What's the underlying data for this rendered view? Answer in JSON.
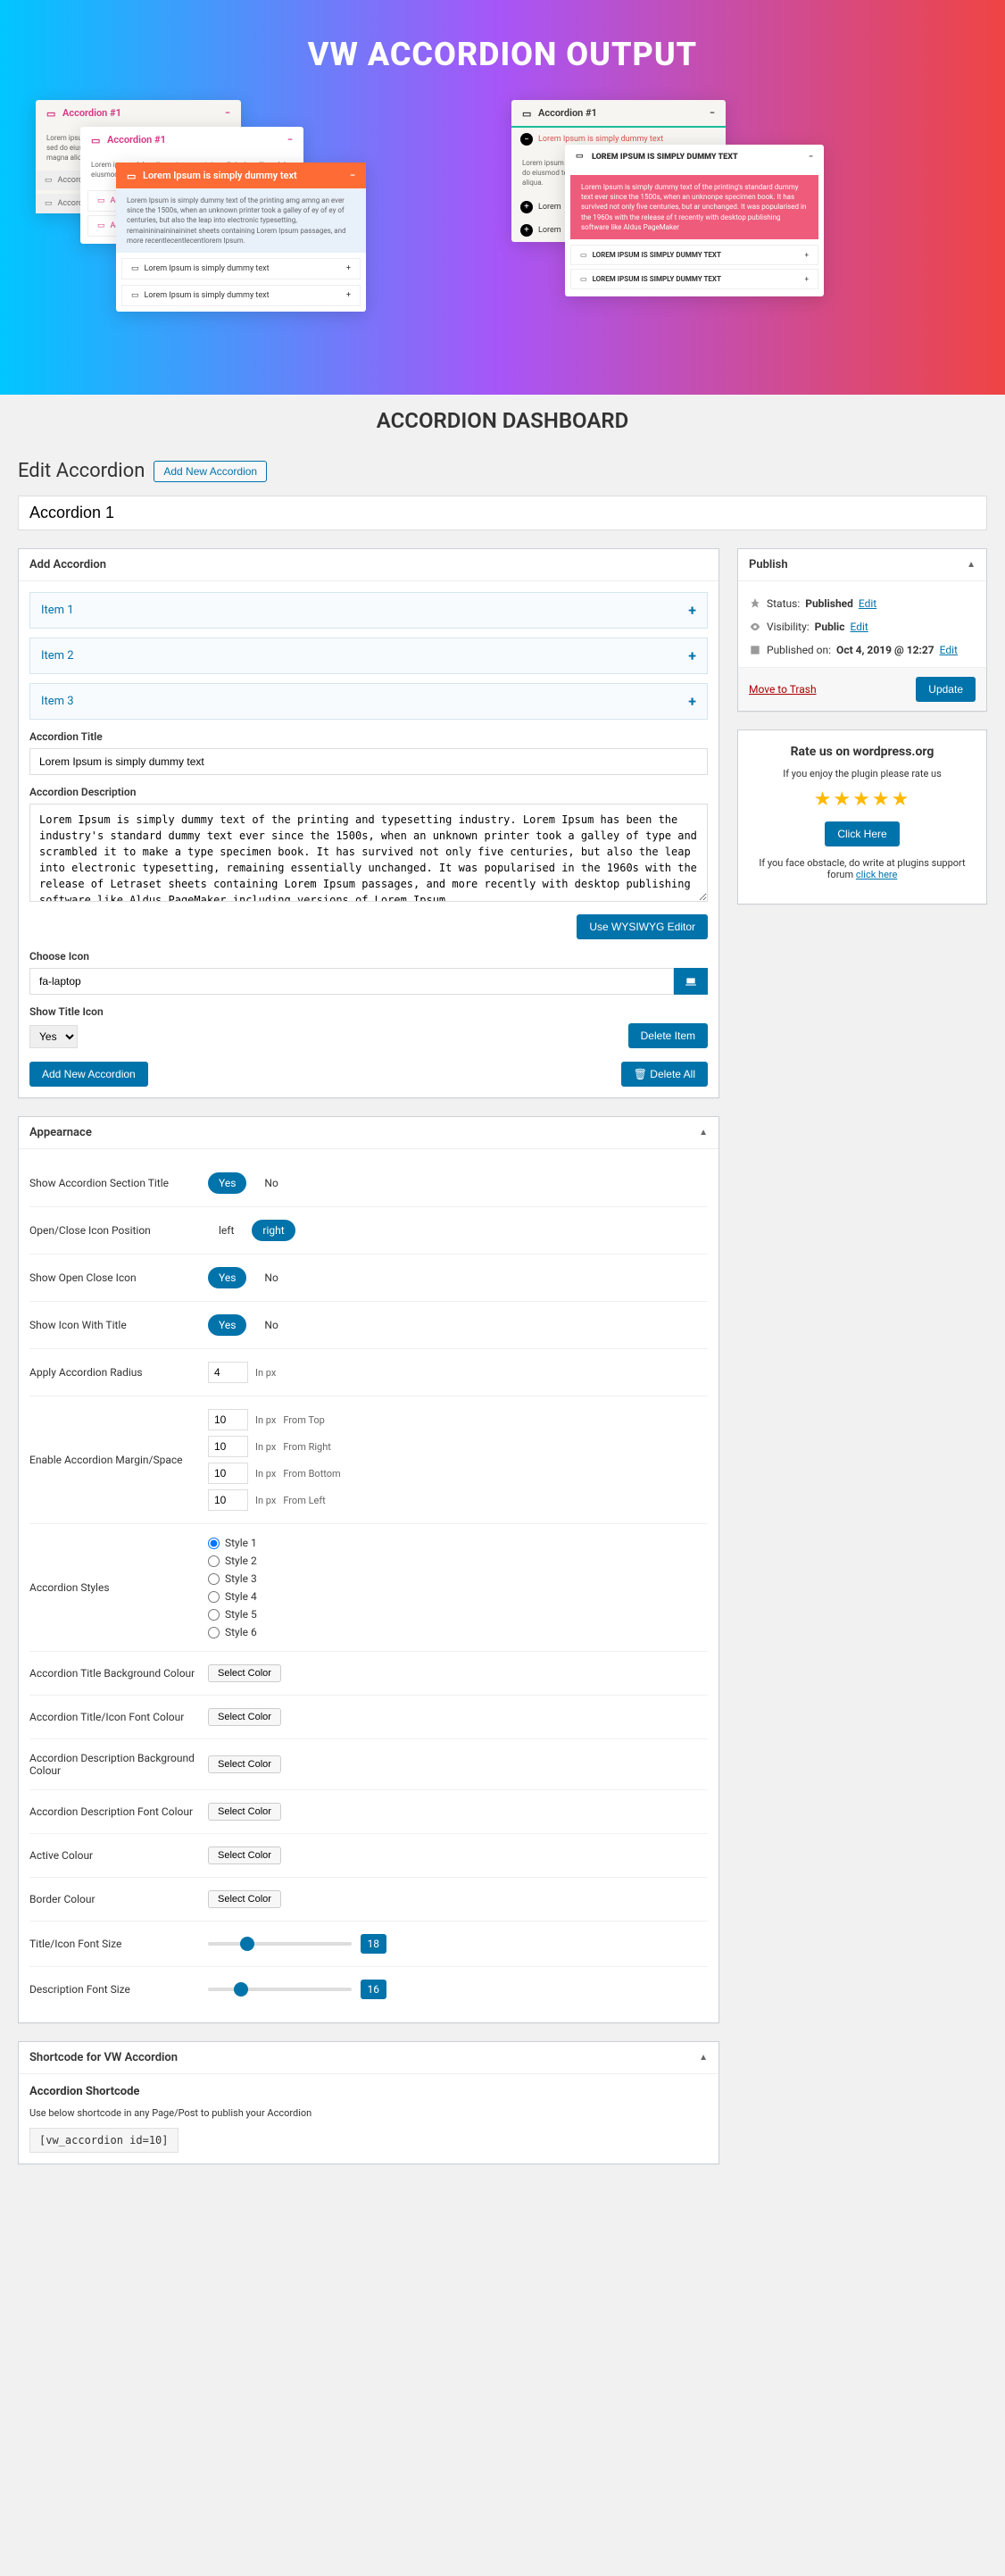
{
  "hero": {
    "title": "VW ACCORDION OUTPUT"
  },
  "previews": {
    "left": {
      "title": "Accordion #1",
      "lorem_short": "Lorem ipsum dolor sit amet, consectetur adipiscing elit, sed do eiusmod tempor incididunt ut labore et dolore magna aliqua.",
      "bar_text": "Lorem Ipsum is simply dummy text",
      "body": "Lorem Ipsum is simply dummy text of the printing amg amng an ever since the 1500s, when an unknown printer took a galley of ey of ey of centuries, but also the leap into electronic typesetting, remainininaininaininet sheets containing Lorem Ipsum passages, and more recentlecentlecentlorem Ipsum."
    },
    "right": {
      "title": "Accordion #1",
      "bar_upper": "LOREM IPSUM IS SIMPLY DUMMY TEXT",
      "body": "Lorem Ipsum is simply dummy text of the printing's standard dummy text ever since the 1500s, when an unknonpe specimen book. It has survived not only five centuries, but ar unchanged. It was popularised in the 1960s with the release of t recently with desktop publishing software like Aldus PageMaker"
    }
  },
  "dashboard_title": "ACCORDION DASHBOARD",
  "page": {
    "heading": "Edit Accordion",
    "add_new": "Add New Accordion"
  },
  "post_title": "Accordion 1",
  "add_section": {
    "heading": "Add Accordion",
    "items": [
      "Item 1",
      "Item 2",
      "Item 3"
    ],
    "labels": {
      "title": "Accordion Title",
      "title_val": "Lorem Ipsum is simply dummy text",
      "desc": "Accordion Description",
      "desc_val": "Lorem Ipsum is simply dummy text of the printing and typesetting industry. Lorem Ipsum has been the industry's standard dummy text ever since the 1500s, when an unknown printer took a galley of type and scrambled it to make a type specimen book. It has survived not only five centuries, but also the leap into electronic typesetting, remaining essentially unchanged. It was popularised in the 1960s with the release of Letraset sheets containing Lorem Ipsum passages, and more recently with desktop publishing software like Aldus PageMaker including versions of Lorem Ipsum.",
      "wysiwyg": "Use WYSIWYG Editor",
      "choose_icon": "Choose Icon",
      "icon_val": "fa-laptop",
      "show_title_icon": "Show Title Icon",
      "show_title_icon_val": "Yes",
      "delete_item": "Delete Item",
      "add_new_acc": "Add New Accordion",
      "delete_all": "Delete All"
    }
  },
  "publish": {
    "heading": "Publish",
    "status_lbl": "Status:",
    "status_val": "Published",
    "vis_lbl": "Visibility:",
    "vis_val": "Public",
    "pub_lbl": "Published on:",
    "pub_val": "Oct 4, 2019 @ 12:27",
    "edit": "Edit",
    "trash": "Move to Trash",
    "update": "Update"
  },
  "rate": {
    "heading": "Rate us on wordpress.org",
    "enjoy": "If you enjoy the plugin please rate us",
    "btn": "Click Here",
    "obstacle": "If you face obstacle, do write at plugins support forum ",
    "link": "click here"
  },
  "appearance": {
    "heading": "Appearnace",
    "rows": {
      "show_section_title": "Show Accordion Section Title",
      "icon_pos": "Open/Close Icon Position",
      "show_open_close": "Show Open Close Icon",
      "show_icon_title": "Show Icon With Title",
      "radius": "Apply Accordion Radius",
      "margin": "Enable Accordion Margin/Space",
      "styles": "Accordion Styles",
      "title_bg": "Accordion Title Background Colour",
      "title_font": "Accordion Title/Icon Font Colour",
      "desc_bg": "Accordion Description Background Colour",
      "desc_font": "Accordion Description Font Colour",
      "active": "Active Colour",
      "border": "Border Colour",
      "title_size": "Title/Icon Font Size",
      "desc_size": "Description Font Size"
    },
    "yes": "Yes",
    "no": "No",
    "left": "left",
    "right": "right",
    "radius_val": "4",
    "unit": "In px",
    "margins": {
      "top": "10",
      "right": "10",
      "bottom": "10",
      "left": "10",
      "top_lbl": "From Top",
      "right_lbl": "From Right",
      "bottom_lbl": "From Bottom",
      "left_lbl": "From Left"
    },
    "style_opts": [
      "Style 1",
      "Style 2",
      "Style 3",
      "Style 4",
      "Style 5",
      "Style 6"
    ],
    "select_color": "Select Color",
    "title_size_val": "18",
    "desc_size_val": "16"
  },
  "shortcode": {
    "heading": "Shortcode for VW Accordion",
    "sub": "Accordion Shortcode",
    "hint": "Use below shortcode in any Page/Post to publish your Accordion",
    "code": "[vw_accordion id=10]"
  }
}
